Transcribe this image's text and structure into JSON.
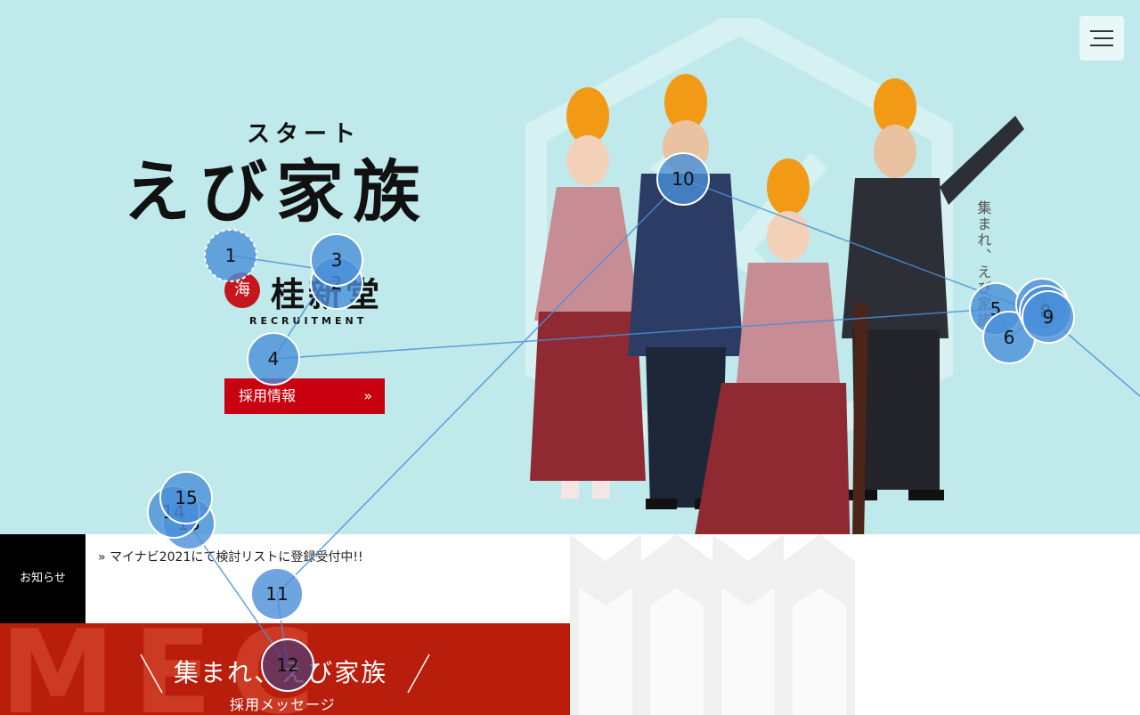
{
  "hero": {
    "start_label": "スタート",
    "title": "えび家族",
    "logo_mark": "海",
    "logo_name": "桂新堂",
    "logo_sub": "RECRUITMENT",
    "cta_label": "採用情報",
    "cta_arrow": "»",
    "vertical_text": "集まれ、えび家族"
  },
  "news": {
    "label": "お知らせ",
    "item": "» マイナビ2021にて検討リストに登録受付中!!"
  },
  "banner": {
    "bg_text": "MEC",
    "title": "集まれ、えび家族",
    "subtitle": "採用メッセージ"
  },
  "markers": [
    "1",
    "2",
    "3",
    "4",
    "5",
    "6",
    "7",
    "8",
    "9",
    "10",
    "11",
    "12",
    "13",
    "14",
    "15"
  ],
  "colors": {
    "hero_bg": "#bfe9ea",
    "cta": "#c8000f",
    "banner": "#b81e0b",
    "marker": "#4a8fd8"
  }
}
